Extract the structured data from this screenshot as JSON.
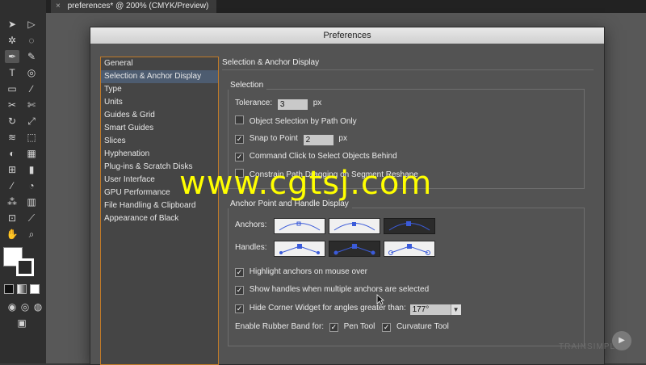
{
  "document": {
    "tab_title": "preferences* @ 200% (CMYK/Preview)",
    "close_glyph": "×"
  },
  "dialog": {
    "title": "Preferences",
    "categories": [
      "General",
      "Selection & Anchor Display",
      "Type",
      "Units",
      "Guides & Grid",
      "Smart Guides",
      "Slices",
      "Hyphenation",
      "Plug-ins & Scratch Disks",
      "User Interface",
      "GPU Performance",
      "File Handling & Clipboard",
      "Appearance of Black"
    ],
    "selected_category": "Selection & Anchor Display",
    "pane_title": "Selection & Anchor Display",
    "selection": {
      "label": "Selection",
      "tolerance_label": "Tolerance:",
      "tolerance_value": "3",
      "tolerance_unit": "px",
      "object_selection_label": "Object Selection by Path Only",
      "object_selection_checked": false,
      "snap_label": "Snap to Point",
      "snap_value": "2",
      "snap_unit": "px",
      "snap_checked": true,
      "command_click_label": "Command Click to Select Objects Behind",
      "command_click_checked": true,
      "constrain_label": "Constrain Path Dragging on Segment Reshape",
      "constrain_checked": false
    },
    "anchor_display": {
      "label": "Anchor Point and Handle Display",
      "anchors_label": "Anchors:",
      "handles_label": "Handles:",
      "anchors_selected_index": 2,
      "handles_selected_index": 1,
      "highlight_label": "Highlight anchors on mouse over",
      "highlight_checked": true,
      "show_handles_label": "Show handles when multiple anchors are selected",
      "show_handles_checked": true,
      "hide_corner_label": "Hide Corner Widget for angles greater than:",
      "hide_corner_checked": true,
      "angle_value": "177°",
      "rubber_band_label": "Enable Rubber Band for:",
      "pen_tool_label": "Pen Tool",
      "pen_tool_checked": true,
      "curvature_tool_label": "Curvature Tool",
      "curvature_tool_checked": true
    }
  },
  "watermark": "www.cgtsj.com",
  "brand": "TRAINSIMPLE",
  "colors": {
    "accent": "#c07a28",
    "selection": "#4d5c70",
    "watermark": "#ffff00",
    "anchor_blue": "#3b5bd9"
  }
}
